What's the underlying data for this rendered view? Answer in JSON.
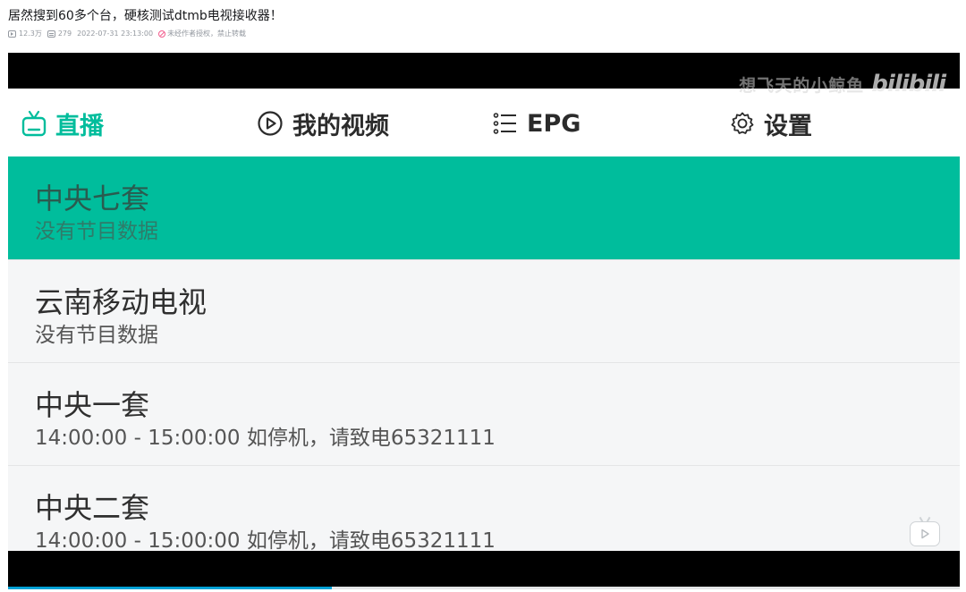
{
  "page": {
    "title": "居然搜到60多个台，硬核测试dtmb电视接收器！",
    "views": "12.3万",
    "danmaku": "279",
    "datetime": "2022-07-31 23:13:00",
    "copyright_notice": "未经作者授权，禁止转载"
  },
  "player": {
    "watermark_text": "想飞天的小鲸鱼",
    "watermark_logo": "bilibili",
    "progress_fraction": 0.34,
    "accent_color": "#00bd9c"
  },
  "tabs": [
    {
      "label": "直播",
      "icon": "tv-icon",
      "active": true
    },
    {
      "label": "我的视频",
      "icon": "play-circle-icon",
      "active": false
    },
    {
      "label": "EPG",
      "icon": "list-icon",
      "active": false
    },
    {
      "label": "设置",
      "icon": "gear-icon",
      "active": false
    }
  ],
  "channels": [
    {
      "name": "中央七套",
      "program": "没有节目数据",
      "selected": true
    },
    {
      "name": "云南移动电视",
      "program": "没有节目数据",
      "selected": false
    },
    {
      "name": "中央一套",
      "program": "14:00:00 - 15:00:00  如停机，请致电65321111",
      "selected": false
    },
    {
      "name": "中央二套",
      "program": "14:00:00 - 15:00:00  如停机，请致电65321111",
      "selected": false
    }
  ]
}
